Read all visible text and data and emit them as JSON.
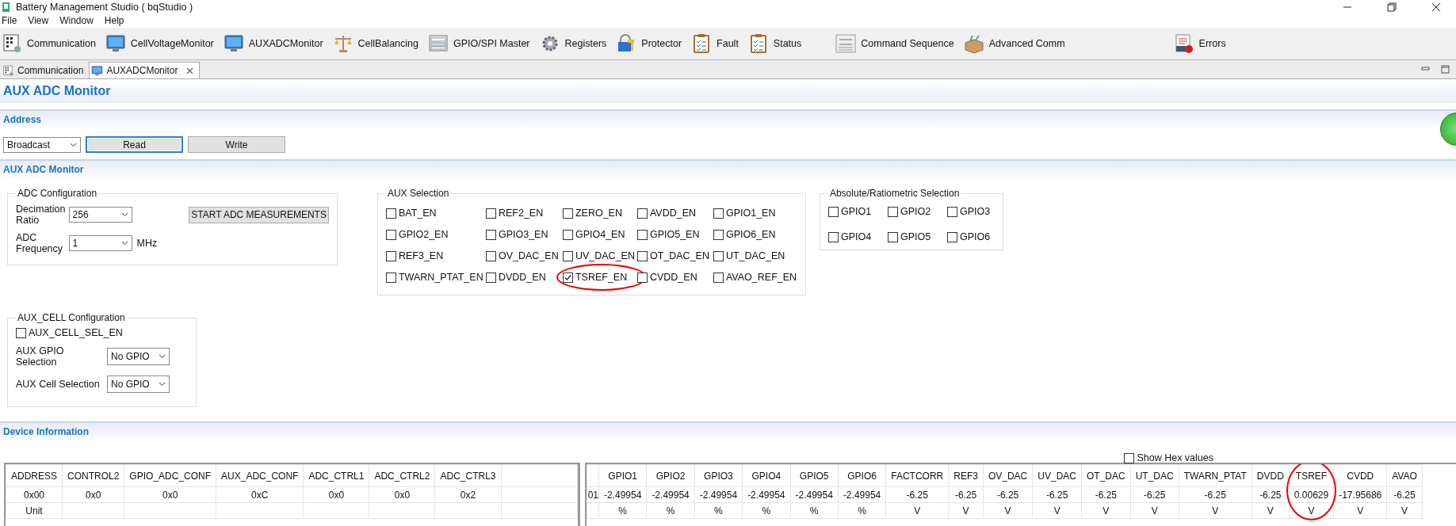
{
  "window": {
    "title": "Battery Management Studio ( bqStudio )"
  },
  "menu": [
    {
      "label": "File"
    },
    {
      "label": "View"
    },
    {
      "label": "Window"
    },
    {
      "label": "Help"
    }
  ],
  "toolbar": [
    {
      "label": "Communication",
      "kind": "chip"
    },
    {
      "label": "CellVoltageMonitor",
      "kind": "monitor"
    },
    {
      "label": "AUXADCMonitor",
      "kind": "monitor"
    },
    {
      "label": "CellBalancing",
      "kind": "scale"
    },
    {
      "label": "GPIO/SPI Master",
      "kind": "forms"
    },
    {
      "label": "Registers",
      "kind": "gear"
    },
    {
      "label": "Protector",
      "kind": "lock"
    },
    {
      "label": "Fault",
      "kind": "clipboard"
    },
    {
      "label": "Status",
      "kind": "clipboard"
    },
    {
      "label": "Command Sequence",
      "kind": "abc"
    },
    {
      "label": "Advanced Comm",
      "kind": "toolbox"
    },
    {
      "label": "Errors",
      "kind": "errors"
    }
  ],
  "tabs": [
    {
      "label": "Communication",
      "kind": "chip",
      "selected": false,
      "closable": false
    },
    {
      "label": "AUXADCMonitor",
      "kind": "monitor",
      "selected": true,
      "closable": true
    }
  ],
  "page_title": "AUX ADC Monitor",
  "address": {
    "section": "Address",
    "dropdown": "Broadcast",
    "buttons": [
      {
        "label": "Read",
        "focused": true
      },
      {
        "label": "Write",
        "focused": false
      }
    ]
  },
  "monitor_section": "AUX ADC Monitor",
  "adc_config": {
    "title": "ADC Configuration",
    "decimation": {
      "label": "Decimation Ratio",
      "value": "256"
    },
    "frequency": {
      "label": "ADC Frequency",
      "value": "1",
      "unit": "MHz"
    },
    "start_button": "START ADC MEASUREMENTS"
  },
  "aux_selection": {
    "title": "AUX Selection",
    "items": [
      {
        "label": "BAT_EN",
        "checked": false,
        "circled": false
      },
      {
        "label": "REF2_EN",
        "checked": false,
        "circled": false
      },
      {
        "label": "ZERO_EN",
        "checked": false,
        "circled": false
      },
      {
        "label": "AVDD_EN",
        "checked": false,
        "circled": false
      },
      {
        "label": "GPIO1_EN",
        "checked": false,
        "circled": false
      },
      {
        "label": "GPIO2_EN",
        "checked": false,
        "circled": false
      },
      {
        "label": "GPIO3_EN",
        "checked": false,
        "circled": false
      },
      {
        "label": "GPIO4_EN",
        "checked": false,
        "circled": false
      },
      {
        "label": "GPIO5_EN",
        "checked": false,
        "circled": false
      },
      {
        "label": "GPIO6_EN",
        "checked": false,
        "circled": false
      },
      {
        "label": "REF3_EN",
        "checked": false,
        "circled": false
      },
      {
        "label": "OV_DAC_EN",
        "checked": false,
        "circled": false
      },
      {
        "label": "UV_DAC_EN",
        "checked": false,
        "circled": false
      },
      {
        "label": "OT_DAC_EN",
        "checked": false,
        "circled": false
      },
      {
        "label": "UT_DAC_EN",
        "checked": false,
        "circled": false
      },
      {
        "label": "TWARN_PTAT_EN",
        "checked": false,
        "circled": false
      },
      {
        "label": "DVDD_EN",
        "checked": false,
        "circled": false
      },
      {
        "label": "TSREF_EN",
        "checked": true,
        "circled": true
      },
      {
        "label": "CVDD_EN",
        "checked": false,
        "circled": false
      },
      {
        "label": "AVAO_REF_EN",
        "checked": false,
        "circled": false
      }
    ]
  },
  "ratiometric": {
    "title": "Absolute/Ratiometric Selection",
    "items": [
      {
        "label": "GPIO1",
        "checked": false
      },
      {
        "label": "GPIO2",
        "checked": false
      },
      {
        "label": "GPIO3",
        "checked": false
      },
      {
        "label": "GPIO4",
        "checked": false
      },
      {
        "label": "GPIO5",
        "checked": false
      },
      {
        "label": "GPIO6",
        "checked": false
      }
    ]
  },
  "aux_cell": {
    "title": "AUX_CELL Configuration",
    "enable": {
      "label": "AUX_CELL_SEL_EN",
      "checked": false
    },
    "selects": [
      {
        "label": "AUX GPIO Selection",
        "value": "No GPIO"
      },
      {
        "label": "AUX Cell Selection",
        "value": "No GPIO"
      }
    ]
  },
  "device_info": {
    "section": "Device Information",
    "show_hex": {
      "label": "Show Hex values",
      "checked": false
    },
    "left_table": {
      "columns": [
        "ADDRESS",
        "CONTROL2",
        "GPIO_ADC_CONF",
        "AUX_ADC_CONF",
        "ADC_CTRL1",
        "ADC_CTRL2",
        "ADC_CTRL3"
      ],
      "values": [
        "0x00",
        "0x0",
        "0x0",
        "0xC",
        "0x0",
        "0x0",
        "0x2"
      ],
      "units": [
        "Unit"
      ]
    },
    "right_table": {
      "cut_value": "01",
      "columns": [
        {
          "name": "GPIO1",
          "value": "-2.49954",
          "unit": "%",
          "circled": false
        },
        {
          "name": "GPIO2",
          "value": "-2.49954",
          "unit": "%",
          "circled": false
        },
        {
          "name": "GPIO3",
          "value": "-2.49954",
          "unit": "%",
          "circled": false
        },
        {
          "name": "GPIO4",
          "value": "-2.49954",
          "unit": "%",
          "circled": false
        },
        {
          "name": "GPIO5",
          "value": "-2.49954",
          "unit": "%",
          "circled": false
        },
        {
          "name": "GPIO6",
          "value": "-2.49954",
          "unit": "%",
          "circled": false
        },
        {
          "name": "FACTCORR",
          "value": "-6.25",
          "unit": "V",
          "circled": false
        },
        {
          "name": "REF3",
          "value": "-6.25",
          "unit": "V",
          "circled": false
        },
        {
          "name": "OV_DAC",
          "value": "-6.25",
          "unit": "V",
          "circled": false
        },
        {
          "name": "UV_DAC",
          "value": "-6.25",
          "unit": "V",
          "circled": false
        },
        {
          "name": "OT_DAC",
          "value": "-6.25",
          "unit": "V",
          "circled": false
        },
        {
          "name": "UT_DAC",
          "value": "-6.25",
          "unit": "V",
          "circled": false
        },
        {
          "name": "TWARN_PTAT",
          "value": "-6.25",
          "unit": "V",
          "circled": false
        },
        {
          "name": "DVDD",
          "value": "-6.25",
          "unit": "V",
          "circled": false
        },
        {
          "name": "TSREF",
          "value": "0.00629",
          "unit": "V",
          "circled": true
        },
        {
          "name": "CVDD",
          "value": "-17.95686",
          "unit": "V",
          "circled": false
        },
        {
          "name": "AVAO",
          "value": "-6.25",
          "unit": "V",
          "circled": false
        }
      ]
    }
  }
}
